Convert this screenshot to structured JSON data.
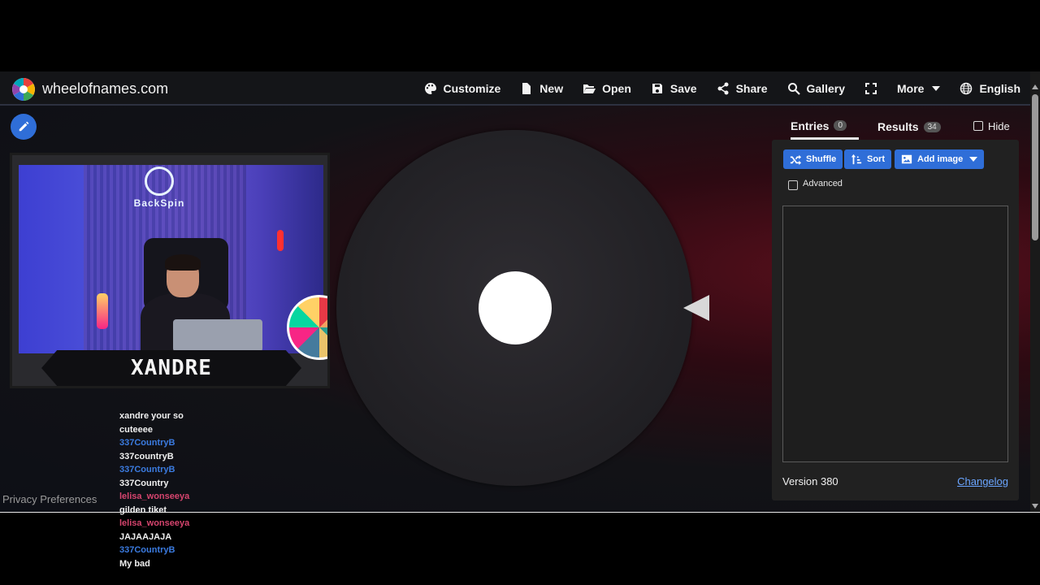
{
  "header": {
    "site_name": "wheelofnames.com",
    "menu": [
      {
        "label": "Customize",
        "icon": "palette-icon"
      },
      {
        "label": "New",
        "icon": "file-icon"
      },
      {
        "label": "Open",
        "icon": "folder-open-icon"
      },
      {
        "label": "Save",
        "icon": "floppy-disk-icon"
      },
      {
        "label": "Share",
        "icon": "share-icon"
      },
      {
        "label": "Gallery",
        "icon": "search-icon"
      },
      {
        "label": "",
        "icon": "fullscreen-icon"
      },
      {
        "label": "More",
        "icon": "chevron-down-icon"
      },
      {
        "label": "English",
        "icon": "globe-icon"
      }
    ]
  },
  "stream": {
    "brand_text": "BackSpin",
    "streamer_name": "XANDRE"
  },
  "panel": {
    "tabs": [
      {
        "label": "Entries",
        "count": "0",
        "active": true
      },
      {
        "label": "Results",
        "count": "34",
        "active": false
      }
    ],
    "hide_label": "Hide",
    "buttons": {
      "shuffle": "Shuffle",
      "sort": "Sort",
      "add_image": "Add image"
    },
    "advanced_label": "Advanced",
    "version": "Version 380",
    "changelog": "Changelog"
  },
  "privacy": "Privacy Preferences",
  "chat": [
    {
      "user": "",
      "color": "white",
      "message": "xandre your so"
    },
    {
      "user": "",
      "color": "white",
      "message": "cuteeee"
    },
    {
      "user": "337CountryB",
      "color": "blue",
      "message": "337countryB"
    },
    {
      "user": "337CountryB",
      "color": "blue",
      "message": "337Country"
    },
    {
      "user": "lelisa_wonseeya",
      "color": "pink",
      "message": "gilden tiket"
    },
    {
      "user": "lelisa_wonseeya",
      "color": "pink",
      "message": "JAJAAJAJA"
    },
    {
      "user": "337CountryB",
      "color": "blue",
      "message": "My bad"
    }
  ],
  "colors": {
    "accent": "#2f6ed8",
    "topbar": "#141518",
    "panel": "#212121"
  }
}
